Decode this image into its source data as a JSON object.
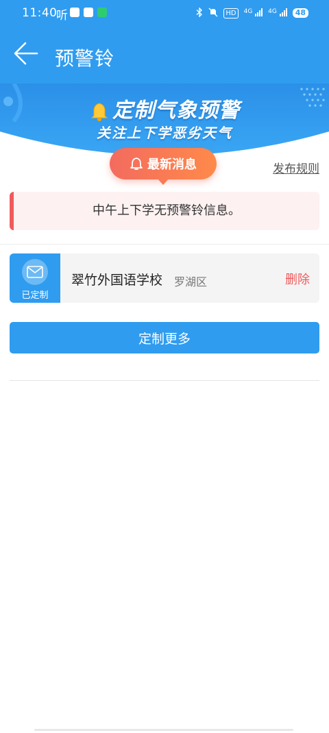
{
  "status_bar": {
    "time": "11:40",
    "ting": "听",
    "hd_label": "HD",
    "net_1": "4G",
    "net_2": "4G",
    "battery": "48"
  },
  "app_bar": {
    "title": "预警铃"
  },
  "banner": {
    "title": "定制气象预警",
    "subtitle": "关注上下学恶劣天气"
  },
  "news": {
    "label": "最新消息",
    "rules_link": "发布规则"
  },
  "notice": {
    "text": "中午上下学无预警铃信息。"
  },
  "subscription": {
    "badge_label": "已定制",
    "school": "翠竹外国语学校",
    "district": "罗湖区",
    "delete_label": "删除"
  },
  "actions": {
    "more_label": "定制更多"
  },
  "colors": {
    "primary": "#2f9cf0",
    "danger": "#ec5b5b",
    "notice_bg": "#fdf1f1",
    "pill_start": "#f36b5f",
    "pill_end": "#ff8a4a"
  }
}
